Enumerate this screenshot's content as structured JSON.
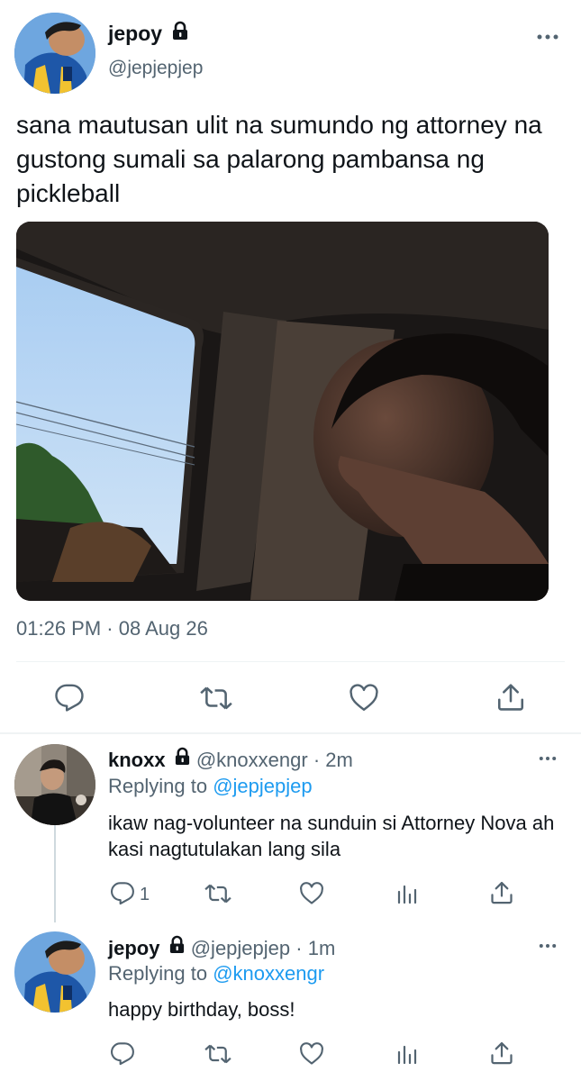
{
  "main_tweet": {
    "display_name": "jepoy",
    "handle": "@jepjepjep",
    "text": "sana mautusan ulit na sumundo ng attorney na gustong sumali sa palarong pambansa ng pickleball",
    "timestamp": "01:26 PM · 08 Aug 26",
    "more_icon": "more-horizontal-icon"
  },
  "replies": [
    {
      "display_name": "knoxx",
      "handle": "@knoxxengr",
      "time": "· 2m",
      "replying_prefix": "Replying to",
      "replying_to": "@jepjepjep",
      "text": "ikaw nag-volunteer na sunduin si Attorney Nova ah kasi nagtutulakan lang sila",
      "reply_count": "1"
    },
    {
      "display_name": "jepoy",
      "handle": "@jepjepjep",
      "time": "· 1m",
      "replying_prefix": "Replying to",
      "replying_to": "@knoxxengr",
      "text": "happy birthday, boss!",
      "reply_count": ""
    }
  ],
  "colors": {
    "text": "#0f1419",
    "muted": "#536471",
    "link": "#1d9bf0",
    "divider": "#eff3f4"
  }
}
